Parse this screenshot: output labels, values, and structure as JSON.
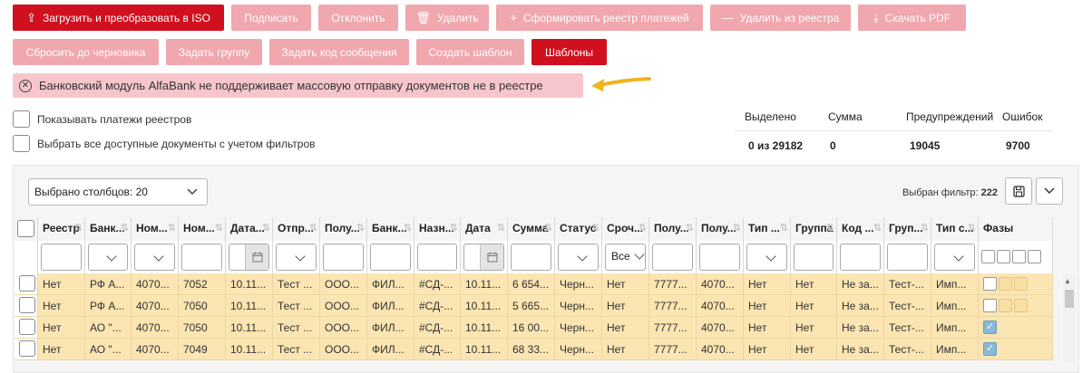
{
  "toolbar": {
    "row1": [
      {
        "name": "upload-convert-iso-button",
        "icon": "upload-icon",
        "glyph": "⇪",
        "label": "Загрузить и преобразовать в ISO",
        "primary": true,
        "w": 233
      },
      {
        "name": "sign-button",
        "icon": "",
        "glyph": "",
        "label": "Подписать",
        "primary": false,
        "w": 88
      },
      {
        "name": "reject-button",
        "icon": "",
        "glyph": "",
        "label": "Отклонить",
        "primary": false,
        "w": 88
      },
      {
        "name": "delete-button",
        "icon": "trash-icon",
        "glyph": "🗑",
        "label": "Удалить",
        "primary": false,
        "w": 92
      },
      {
        "name": "create-registry-button",
        "icon": "plus-icon",
        "glyph": "+",
        "label": "Сформировать реестр платежей",
        "primary": false,
        "w": 228
      },
      {
        "name": "remove-from-registry-button",
        "icon": "minus-icon",
        "glyph": "—",
        "label": "Удалить из реестра",
        "primary": false,
        "w": 155
      },
      {
        "name": "download-pdf-button",
        "icon": "download-icon",
        "glyph": "⤓",
        "label": "Скачать PDF",
        "primary": false,
        "w": 119
      }
    ],
    "row2": [
      {
        "name": "reset-to-draft-button",
        "icon": "",
        "glyph": "",
        "label": "Сбросить до черновика",
        "primary": false,
        "w": 161
      },
      {
        "name": "set-group-button",
        "icon": "",
        "glyph": "",
        "label": "Задать группу",
        "primary": false,
        "w": 106
      },
      {
        "name": "set-message-code-button",
        "icon": "",
        "glyph": "",
        "label": "Задать код сообщения",
        "primary": false,
        "w": 154
      },
      {
        "name": "create-template-button",
        "icon": "",
        "glyph": "",
        "label": "Создать шаблон",
        "primary": false,
        "w": 119
      },
      {
        "name": "templates-button",
        "icon": "",
        "glyph": "",
        "label": "Шаблоны",
        "primary": true,
        "w": 83
      }
    ]
  },
  "alert": {
    "icon": "close-circle-icon",
    "text": "Банковский модуль AlfaBank не поддерживает массовую отправку документов не в реестре",
    "arrow_color": "#f0b41c"
  },
  "checkboxes": {
    "show_registry_payments": "Показывать платежи реестров",
    "select_all_filtered": "Выбрать все доступные документы с учетом фильтров"
  },
  "stats": {
    "headers": [
      "Выделено",
      "Сумма",
      "Предупреждений",
      "Ошибок"
    ],
    "values": [
      "0 из 29182",
      "0",
      "19045",
      "9700"
    ]
  },
  "panel": {
    "columns_select": "Выбрано столбцов: 20",
    "filter_label": "Выбран фильтр:",
    "filter_count": "222",
    "save_icon": "save-icon",
    "expand_icon": "chevron-down-icon"
  },
  "table": {
    "columns": [
      {
        "label": "Реестр",
        "filter": "text"
      },
      {
        "label": "Банк...",
        "filter": "select"
      },
      {
        "label": "Ном...",
        "filter": "select"
      },
      {
        "label": "Ном...",
        "filter": "text"
      },
      {
        "label": "Дата...",
        "filter": "date"
      },
      {
        "label": "Отпр...",
        "filter": "select"
      },
      {
        "label": "Полу...",
        "filter": "text"
      },
      {
        "label": "Банк...",
        "filter": "text"
      },
      {
        "label": "Назн...",
        "filter": "text"
      },
      {
        "label": "Дата",
        "filter": "date"
      },
      {
        "label": "Сумма",
        "filter": "text"
      },
      {
        "label": "Статус",
        "filter": "select"
      },
      {
        "label": "Сроч...",
        "filter": "urgent"
      },
      {
        "label": "Полу...",
        "filter": "text"
      },
      {
        "label": "Полу...",
        "filter": "text"
      },
      {
        "label": "Тип ...",
        "filter": "select"
      },
      {
        "label": "Группа",
        "filter": "text"
      },
      {
        "label": "Код ...",
        "filter": "text"
      },
      {
        "label": "Груп...",
        "filter": "text"
      },
      {
        "label": "Тип с...",
        "filter": "select"
      },
      {
        "label": "Фазы",
        "filter": "phases"
      }
    ],
    "urgent_filter_value": "Все",
    "rows": [
      {
        "cells": [
          "Нет",
          "РФ А...",
          "4070...",
          "7052",
          "10.11...",
          "Тест ...",
          "ООО...",
          "ФИЛ...",
          "#СД-...",
          "10.11...",
          "6 654...",
          "Черн...",
          "Нет",
          "7777...",
          "4070...",
          "Нет",
          "Нет",
          "Не за...",
          "Тест-...",
          "Имп..."
        ],
        "phases": "boxes"
      },
      {
        "cells": [
          "Нет",
          "РФ А...",
          "4070...",
          "7050",
          "10.11...",
          "Тест ...",
          "ООО...",
          "ФИЛ...",
          "#СД-...",
          "10.11...",
          "5 665...",
          "Черн...",
          "Нет",
          "7777...",
          "4070...",
          "Нет",
          "Нет",
          "Не за...",
          "Тест-...",
          "Имп..."
        ],
        "phases": "boxes"
      },
      {
        "cells": [
          "Нет",
          "АО \"...",
          "4070...",
          "7050",
          "10.11...",
          "Тест ...",
          "ООО...",
          "ФИЛ...",
          "#СД-...",
          "10.11...",
          "16 00...",
          "Черн...",
          "Нет",
          "7777...",
          "4070...",
          "Нет",
          "Нет",
          "Не за...",
          "Тест-...",
          "Имп..."
        ],
        "phases": "check"
      },
      {
        "cells": [
          "Нет",
          "АО \"...",
          "4070...",
          "7049",
          "10.11...",
          "Тест ...",
          "ООО...",
          "ФИЛ...",
          "#СД-...",
          "10.11...",
          "68 33...",
          "Черн...",
          "Нет",
          "7777...",
          "4070...",
          "Нет",
          "Нет",
          "Не за...",
          "Тест-...",
          "Имп..."
        ],
        "phases": "check"
      }
    ]
  }
}
